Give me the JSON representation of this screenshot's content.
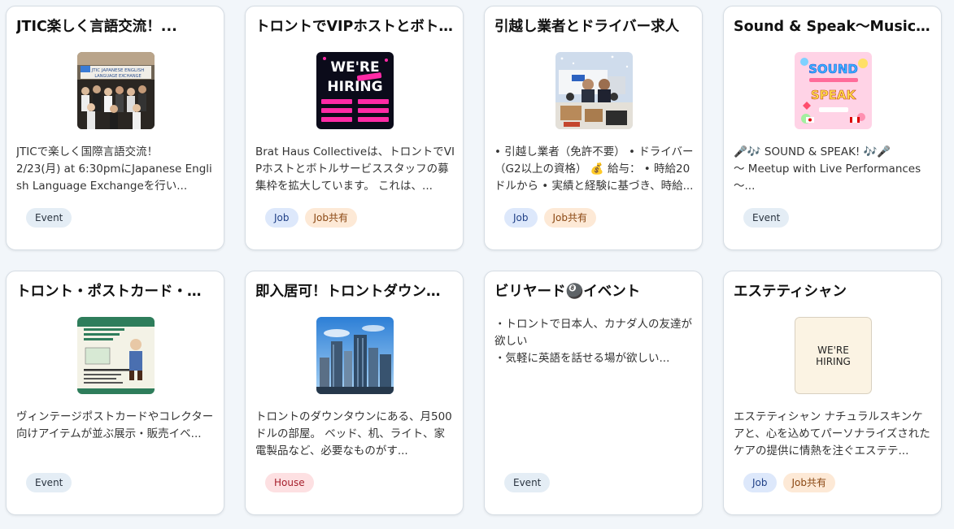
{
  "colors": {
    "event_bg": "#e4edf5",
    "job_bg": "#dde8fb",
    "jobshare_bg": "#fde9d6",
    "house_bg": "#fde0e2"
  },
  "cards": [
    {
      "title": "JTIC楽しく言語交流！...",
      "image": "language-exchange-group-photo",
      "image_text": {
        "l1": "JTIC JAPANESE ENGLISH",
        "l2": "LANGUAGE EXCHANGE"
      },
      "description": "JTICで楽しく国際言語交流！\n2/23(月) at 6:30pmにJapanese English Language Exchangeを行い...",
      "tags": [
        "Event"
      ]
    },
    {
      "title": "トロントでVIPホストとボト...",
      "image": "we-are-hiring-poster",
      "image_text": {
        "l1": "WE'RE",
        "l2": "HIRING"
      },
      "description": "Brat Haus Collectiveは、トロントでVIPホストとボトルサービススタッフの募集枠を拡大しています。 これは、...",
      "tags": [
        "Job",
        "Job共有"
      ]
    },
    {
      "title": "引越し業者とドライバー求人",
      "image": "moving-truck-workers-photo",
      "description": "• 引越し業者（免許不要） • ドライバー（G2以上の資格） 💰 給与： • 時給20ドルから • 実績と経験に基づき、時給...",
      "tags": [
        "Job",
        "Job共有"
      ]
    },
    {
      "title": "Sound & Speak～Music...",
      "image": "sound-speak-flyer",
      "image_text": {
        "l1": "SOUND",
        "l2": "SPEAK"
      },
      "description": "🎤🎶 SOUND & SPEAK! 🎶🎤\n～ Meetup with Live Performances ～...",
      "tags": [
        "Event"
      ]
    },
    {
      "title": "トロント・ポストカード・シ...",
      "image": "postcard-show-flyer",
      "description": "ヴィンテージポストカードやコレクター向けアイテムが並ぶ展示・販売イベ...",
      "tags": [
        "Event"
      ]
    },
    {
      "title": "即入居可！トロントダウンタ...",
      "image": "toronto-skyline-photo",
      "description": "トロントのダウンタウンにある、月500ドルの部屋。 ベッド、机、ライト、家電製品など、必要なものがす...",
      "tags": [
        "House"
      ]
    },
    {
      "title": "ビリヤード🎱イベント",
      "image": null,
      "description": "・トロントで日本人、カナダ人の友達が欲しい\n・気軽に英語を話せる場が欲しい...",
      "tags": [
        "Event"
      ]
    },
    {
      "title": "エステティシャン",
      "image": "we-are-hiring-plain",
      "image_text": {
        "l1": "WE'RE",
        "l2": "HIRING"
      },
      "description": "エステティシャン ナチュラルスキンケアと、心を込めてパーソナライズされたケアの提供に情熱を注ぐエステテ...",
      "tags": [
        "Job",
        "Job共有"
      ]
    }
  ]
}
